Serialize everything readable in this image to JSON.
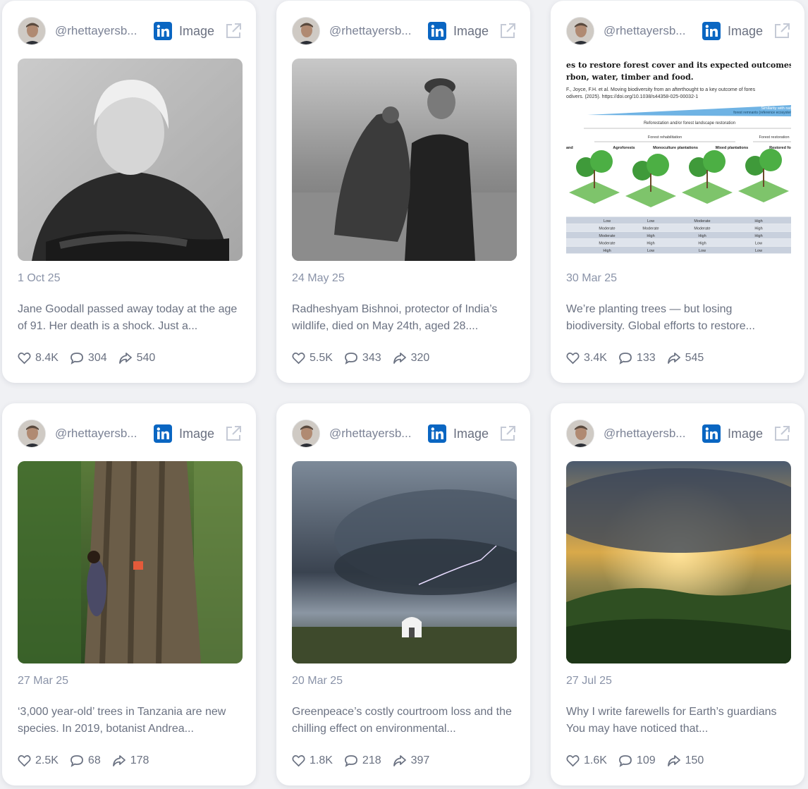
{
  "colors": {
    "linkedin": "#0a66c2",
    "background": "#f0f1f4",
    "card": "#ffffff",
    "muted_text": "#6b7282"
  },
  "icons": {
    "network": "linkedin-icon",
    "open": "external-link-icon",
    "likes": "heart-icon",
    "comments": "comment-icon",
    "shares": "share-icon"
  },
  "posts": [
    {
      "username": "@rhettayersb...",
      "type_label": "Image",
      "image_alt": "Black and white portrait of an elderly woman",
      "date": "1 Oct 25",
      "text": "Jane Goodall passed away today at the age of 91. Her death is a shock. Just a...",
      "likes": "8.4K",
      "comments": "304",
      "shares": "540"
    },
    {
      "username": "@rhettayersb...",
      "type_label": "Image",
      "image_alt": "Black and white photo of a man holding a vulture",
      "date": "24 May 25",
      "text": "Radheshyam Bishnoi, protector of India’s wildlife, died on May 24th, aged 28....",
      "likes": "5.5K",
      "comments": "343",
      "shares": "320"
    },
    {
      "username": "@rhettayersb...",
      "type_label": "Image",
      "image_alt": "Infographic on forest restoration schemes",
      "date": "30 Mar 25",
      "text": "We’re planting trees — but losing biodiversity. Global efforts to restore...",
      "likes": "3.4K",
      "comments": "133",
      "shares": "545",
      "infographic": {
        "title_line1": "es to restore forest cover and its expected outcomes fo",
        "title_line2": "rbon, water, timber and food.",
        "citation_line1": "F., Joyce, F.H. et al. Moving biodiversity from an afterthought to a key outcome of fores",
        "citation_line2": "odivers. (2025). https://doi.org/10.1038/s44358-025-00032-1",
        "similarity_label": "Similarity with nat",
        "similarity_label2": "forest remnants (reference ecosyster",
        "restoration_label": "Reforestation and/or forest landscape restoration",
        "rehab_label": "Forest rehabilitation",
        "restoration_short": "Forest restoration",
        "columns": [
          "and",
          "Agroforests",
          "Monoculture plantations",
          "Mixed plantations",
          "Restored forests"
        ],
        "table": [
          [
            "Low",
            "Low",
            "Moderate",
            "High"
          ],
          [
            "Moderate",
            "Moderate",
            "Moderate",
            "High"
          ],
          [
            "Moderate",
            "High",
            "High",
            "High"
          ],
          [
            "Moderate",
            "High",
            "High",
            "Low"
          ],
          [
            "High",
            "Low",
            "Low",
            "Low"
          ]
        ]
      }
    },
    {
      "username": "@rhettayersb...",
      "type_label": "Image",
      "image_alt": "Man hugging a giant tree trunk in a rainforest",
      "date": "27 Mar 25",
      "text": "‘3,000 year-old’ trees in Tanzania are new species. In 2019, botanist Andrea...",
      "likes": "2.5K",
      "comments": "68",
      "shares": "178"
    },
    {
      "username": "@rhettayersb...",
      "type_label": "Image",
      "image_alt": "Supercell storm over a white barn",
      "date": "20 Mar 25",
      "text": "Greenpeace’s costly courtroom loss and the chilling effect on environmental...",
      "likes": "1.8K",
      "comments": "218",
      "shares": "397"
    },
    {
      "username": "@rhettayersb...",
      "type_label": "Image",
      "image_alt": "Sun breaking through storm clouds over forested hills",
      "date": "27 Jul 25",
      "text": "Why I write farewells for Earth’s guardians You may have noticed that...",
      "likes": "1.6K",
      "comments": "109",
      "shares": "150"
    }
  ]
}
